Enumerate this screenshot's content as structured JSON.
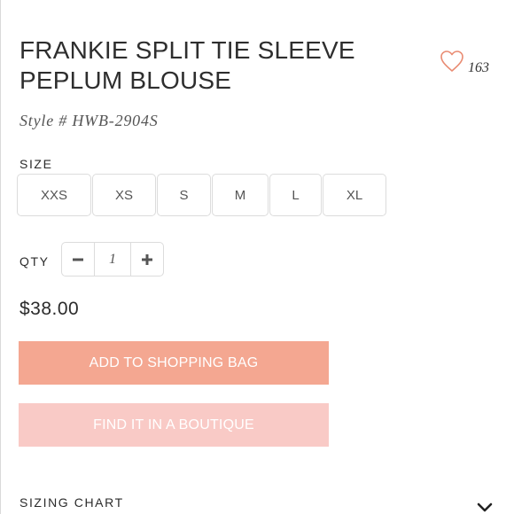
{
  "product": {
    "title": "FRANKIE SPLIT TIE SLEEVE PEPLUM BLOUSE",
    "style_label": "Style # HWB-2904S",
    "favorites_count": "163",
    "price": "$38.00"
  },
  "size": {
    "label": "SIZE",
    "options": [
      "XXS",
      "XS",
      "S",
      "M",
      "L",
      "XL"
    ]
  },
  "quantity": {
    "label": "QTY",
    "value": "1"
  },
  "actions": {
    "add_to_bag": "ADD TO SHOPPING BAG",
    "find_boutique": "FIND IT IN A BOUTIQUE"
  },
  "sizing_chart": {
    "label": "SIZING CHART"
  },
  "icons": {
    "favorite": "heart-outline-icon",
    "decrease": "minus-icon",
    "increase": "plus-icon",
    "expand": "chevron-down-icon"
  },
  "colors": {
    "primary_button": "#f4a791",
    "secondary_button": "#f9cac6",
    "heart": "#e98b72"
  }
}
